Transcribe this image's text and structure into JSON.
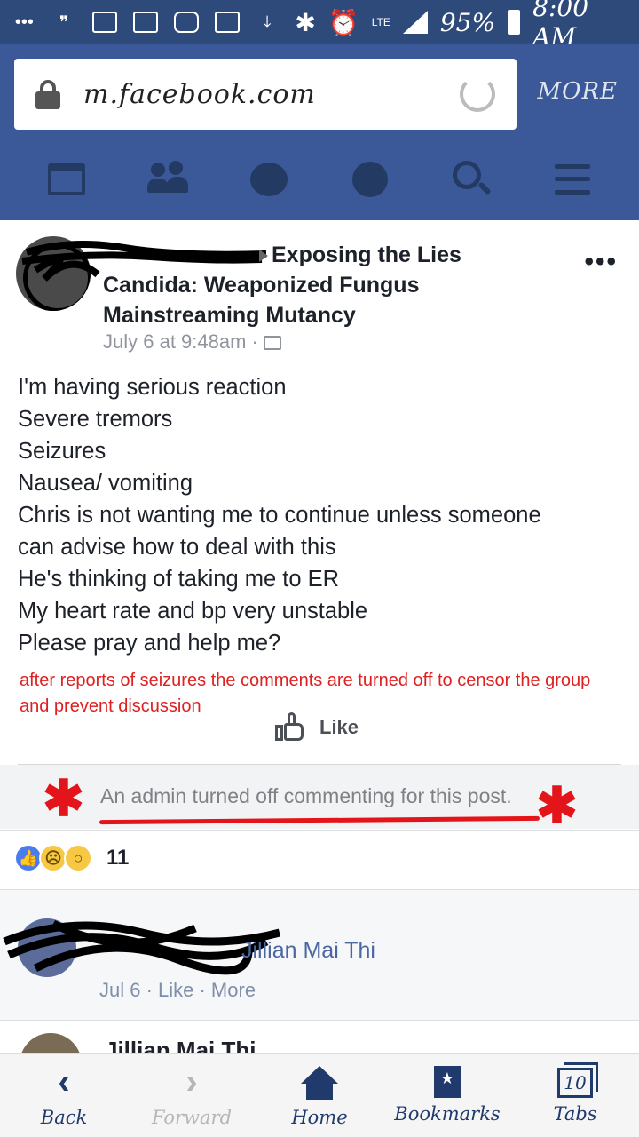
{
  "status_bar": {
    "battery": "95%",
    "time": "8:00 AM",
    "network": "LTE"
  },
  "browser": {
    "url": "m.facebook.com",
    "more_label": "MORE"
  },
  "post": {
    "group_name_line1": "Exposing the Lies",
    "group_name_line2": "Candida: Weaponized Fungus",
    "group_name_line3": "Mainstreaming Mutancy",
    "timestamp": "July 6 at 9:48am ·",
    "menu": "•••",
    "body_lines": [
      "I'm having serious reaction",
      "Severe tremors",
      "Seizures",
      "Nausea/ vomiting",
      "Chris is not wanting me to continue unless someone",
      "can advise how to deal with this",
      "He's thinking of taking me to ER",
      "My heart rate and bp very unstable",
      "Please pray and help me?"
    ],
    "annotation": "after reports of seizures the comments are turned off to censor the group and prevent discussion",
    "like_label": "Like",
    "comments_off_notice": "An admin turned off commenting for this post.",
    "reaction_count": "11"
  },
  "comments": [
    {
      "name": "Jillian Mai Thi",
      "meta": "Jul 6 · Like · More"
    },
    {
      "name": "Jillian Mai Thi"
    }
  ],
  "toolbar": {
    "back": "Back",
    "forward": "Forward",
    "home": "Home",
    "bookmarks": "Bookmarks",
    "tabs": "Tabs",
    "tab_count": "10"
  },
  "colors": {
    "fb_blue": "#3b5998",
    "status_bar": "#2d4a7a",
    "annotation_red": "#e02020",
    "toolbar_blue": "#1f3a6b"
  }
}
